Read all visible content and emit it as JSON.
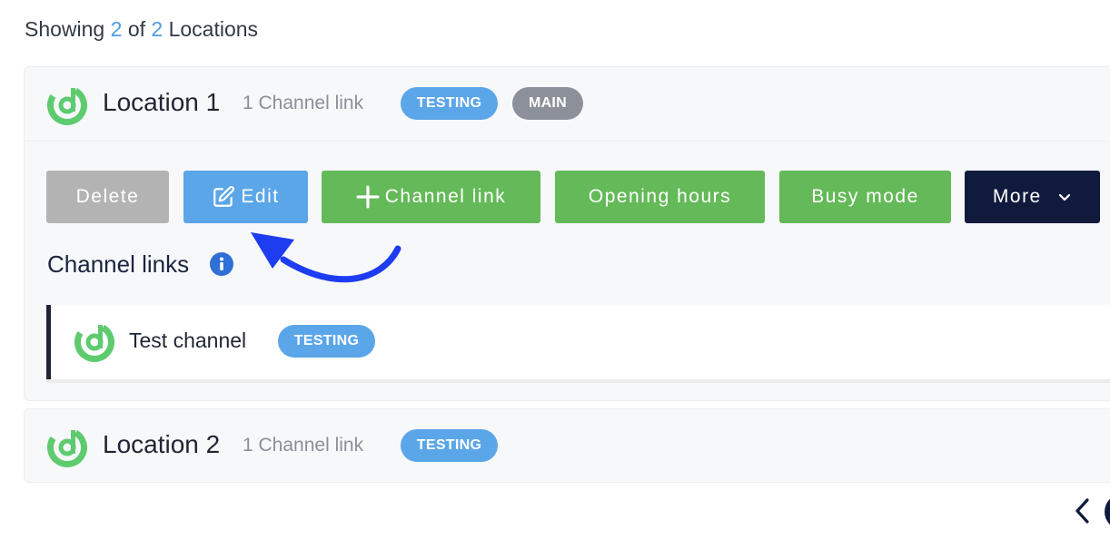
{
  "summary": {
    "prefix": "Showing",
    "shown": "2",
    "of_word": "of",
    "total": "2",
    "suffix": "Locations"
  },
  "locations": [
    {
      "name": "Location 1",
      "channel_count": "1 Channel link",
      "badges": [
        "TESTING",
        "MAIN"
      ],
      "actions": {
        "delete": "Delete",
        "edit": "Edit",
        "channel_link": "Channel link",
        "opening_hours": "Opening hours",
        "busy_mode": "Busy mode",
        "more": "More"
      },
      "channel_links_title": "Channel links",
      "channels": [
        {
          "name": "Test channel",
          "badge": "TESTING"
        }
      ]
    },
    {
      "name": "Location 2",
      "channel_count": "1 Channel link",
      "badges": [
        "TESTING"
      ]
    }
  ],
  "icons": {
    "logo": "deliverect-logo-icon",
    "edit": "edit-icon",
    "add": "plus-icon",
    "more": "chevron-down-icon",
    "info": "info-icon",
    "pager_prev": "chevron-left-icon"
  },
  "colors": {
    "accent_blue": "#5ba6e8",
    "green": "#64b958",
    "navy": "#0f1a3c",
    "gray_button": "#b3b3b3",
    "logo_green": "#5ecb6f",
    "annotation_arrow": "#1e3cf0"
  }
}
